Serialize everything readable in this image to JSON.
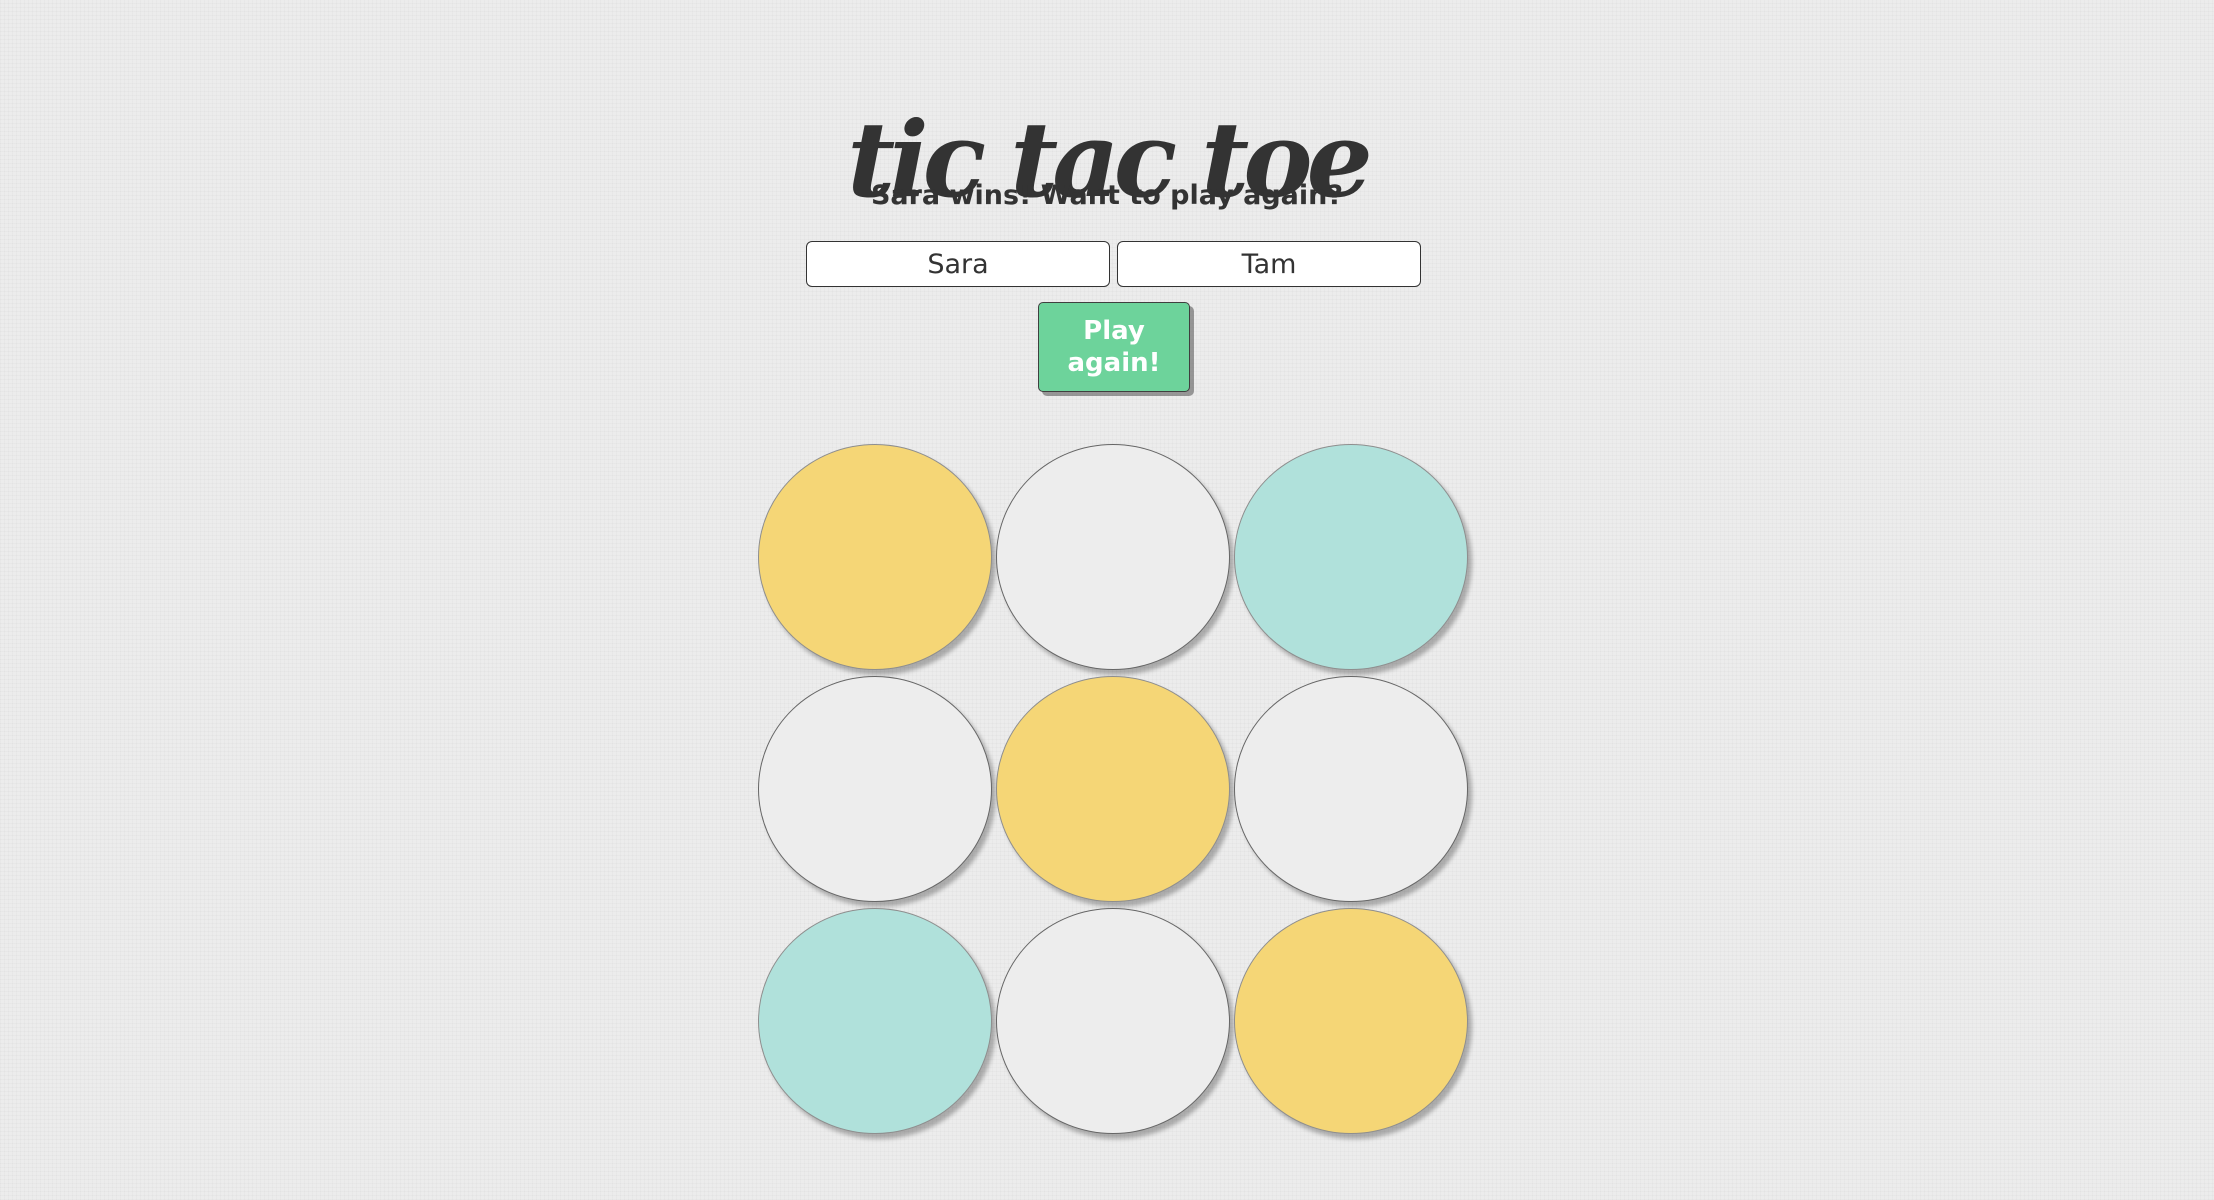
{
  "title": "tic tac toe",
  "status_message": "Sara wins! Want to play again?",
  "players": {
    "player1": "Sara",
    "player2": "Tam"
  },
  "play_button_label": "Play again!",
  "colors": {
    "background": "#ececec",
    "player1": "#f5d676",
    "player2": "#b0e1db",
    "empty": "#ededed",
    "button": "#6dd39b"
  },
  "board": [
    [
      "player1",
      "empty",
      "player2"
    ],
    [
      "empty",
      "player1",
      "empty"
    ],
    [
      "player2",
      "empty",
      "player1"
    ]
  ]
}
